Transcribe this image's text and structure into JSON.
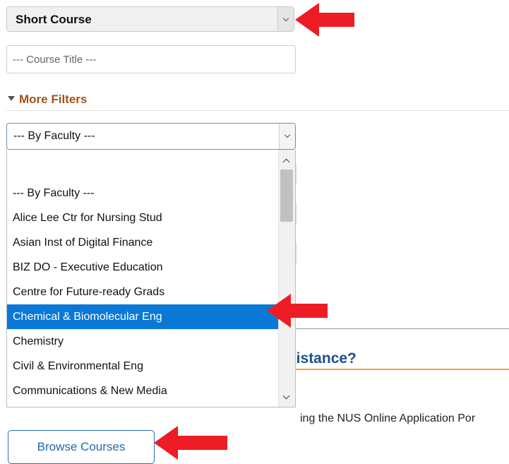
{
  "filters": {
    "course_type": {
      "selected": "Short Course"
    },
    "course_title": {
      "placeholder": "--- Course Title ---",
      "value": ""
    },
    "more_filters": {
      "label": "More Filters",
      "expanded": true
    },
    "faculty": {
      "selected": "--- By Faculty ---",
      "options": [
        "--- By Faculty ---",
        "Alice Lee Ctr for Nursing Stud",
        "Asian Inst of Digital Finance",
        "BIZ DO - Executive Education",
        "Centre for Future-ready Grads",
        "Chemical & Biomolecular Eng",
        "Chemistry",
        "Civil & Environmental Eng",
        "Communications & New Media"
      ],
      "highlighted": "Chemical & Biomolecular Eng"
    }
  },
  "background": {
    "assistance_heading": "sistance?",
    "partial_text": "ing the NUS Online Application Por"
  },
  "actions": {
    "browse_label": "Browse Courses"
  },
  "colors": {
    "annotation_arrow": "#ee1c24",
    "highlight": "#0a78d7",
    "more_filters_text": "#a35317",
    "heading_blue": "#1b4f8c",
    "accent_orange": "#f2a24a"
  },
  "icons": {
    "dropdown": "chevron-down-icon",
    "expander": "triangle-down-icon",
    "annotation": "red-arrow-icon"
  }
}
